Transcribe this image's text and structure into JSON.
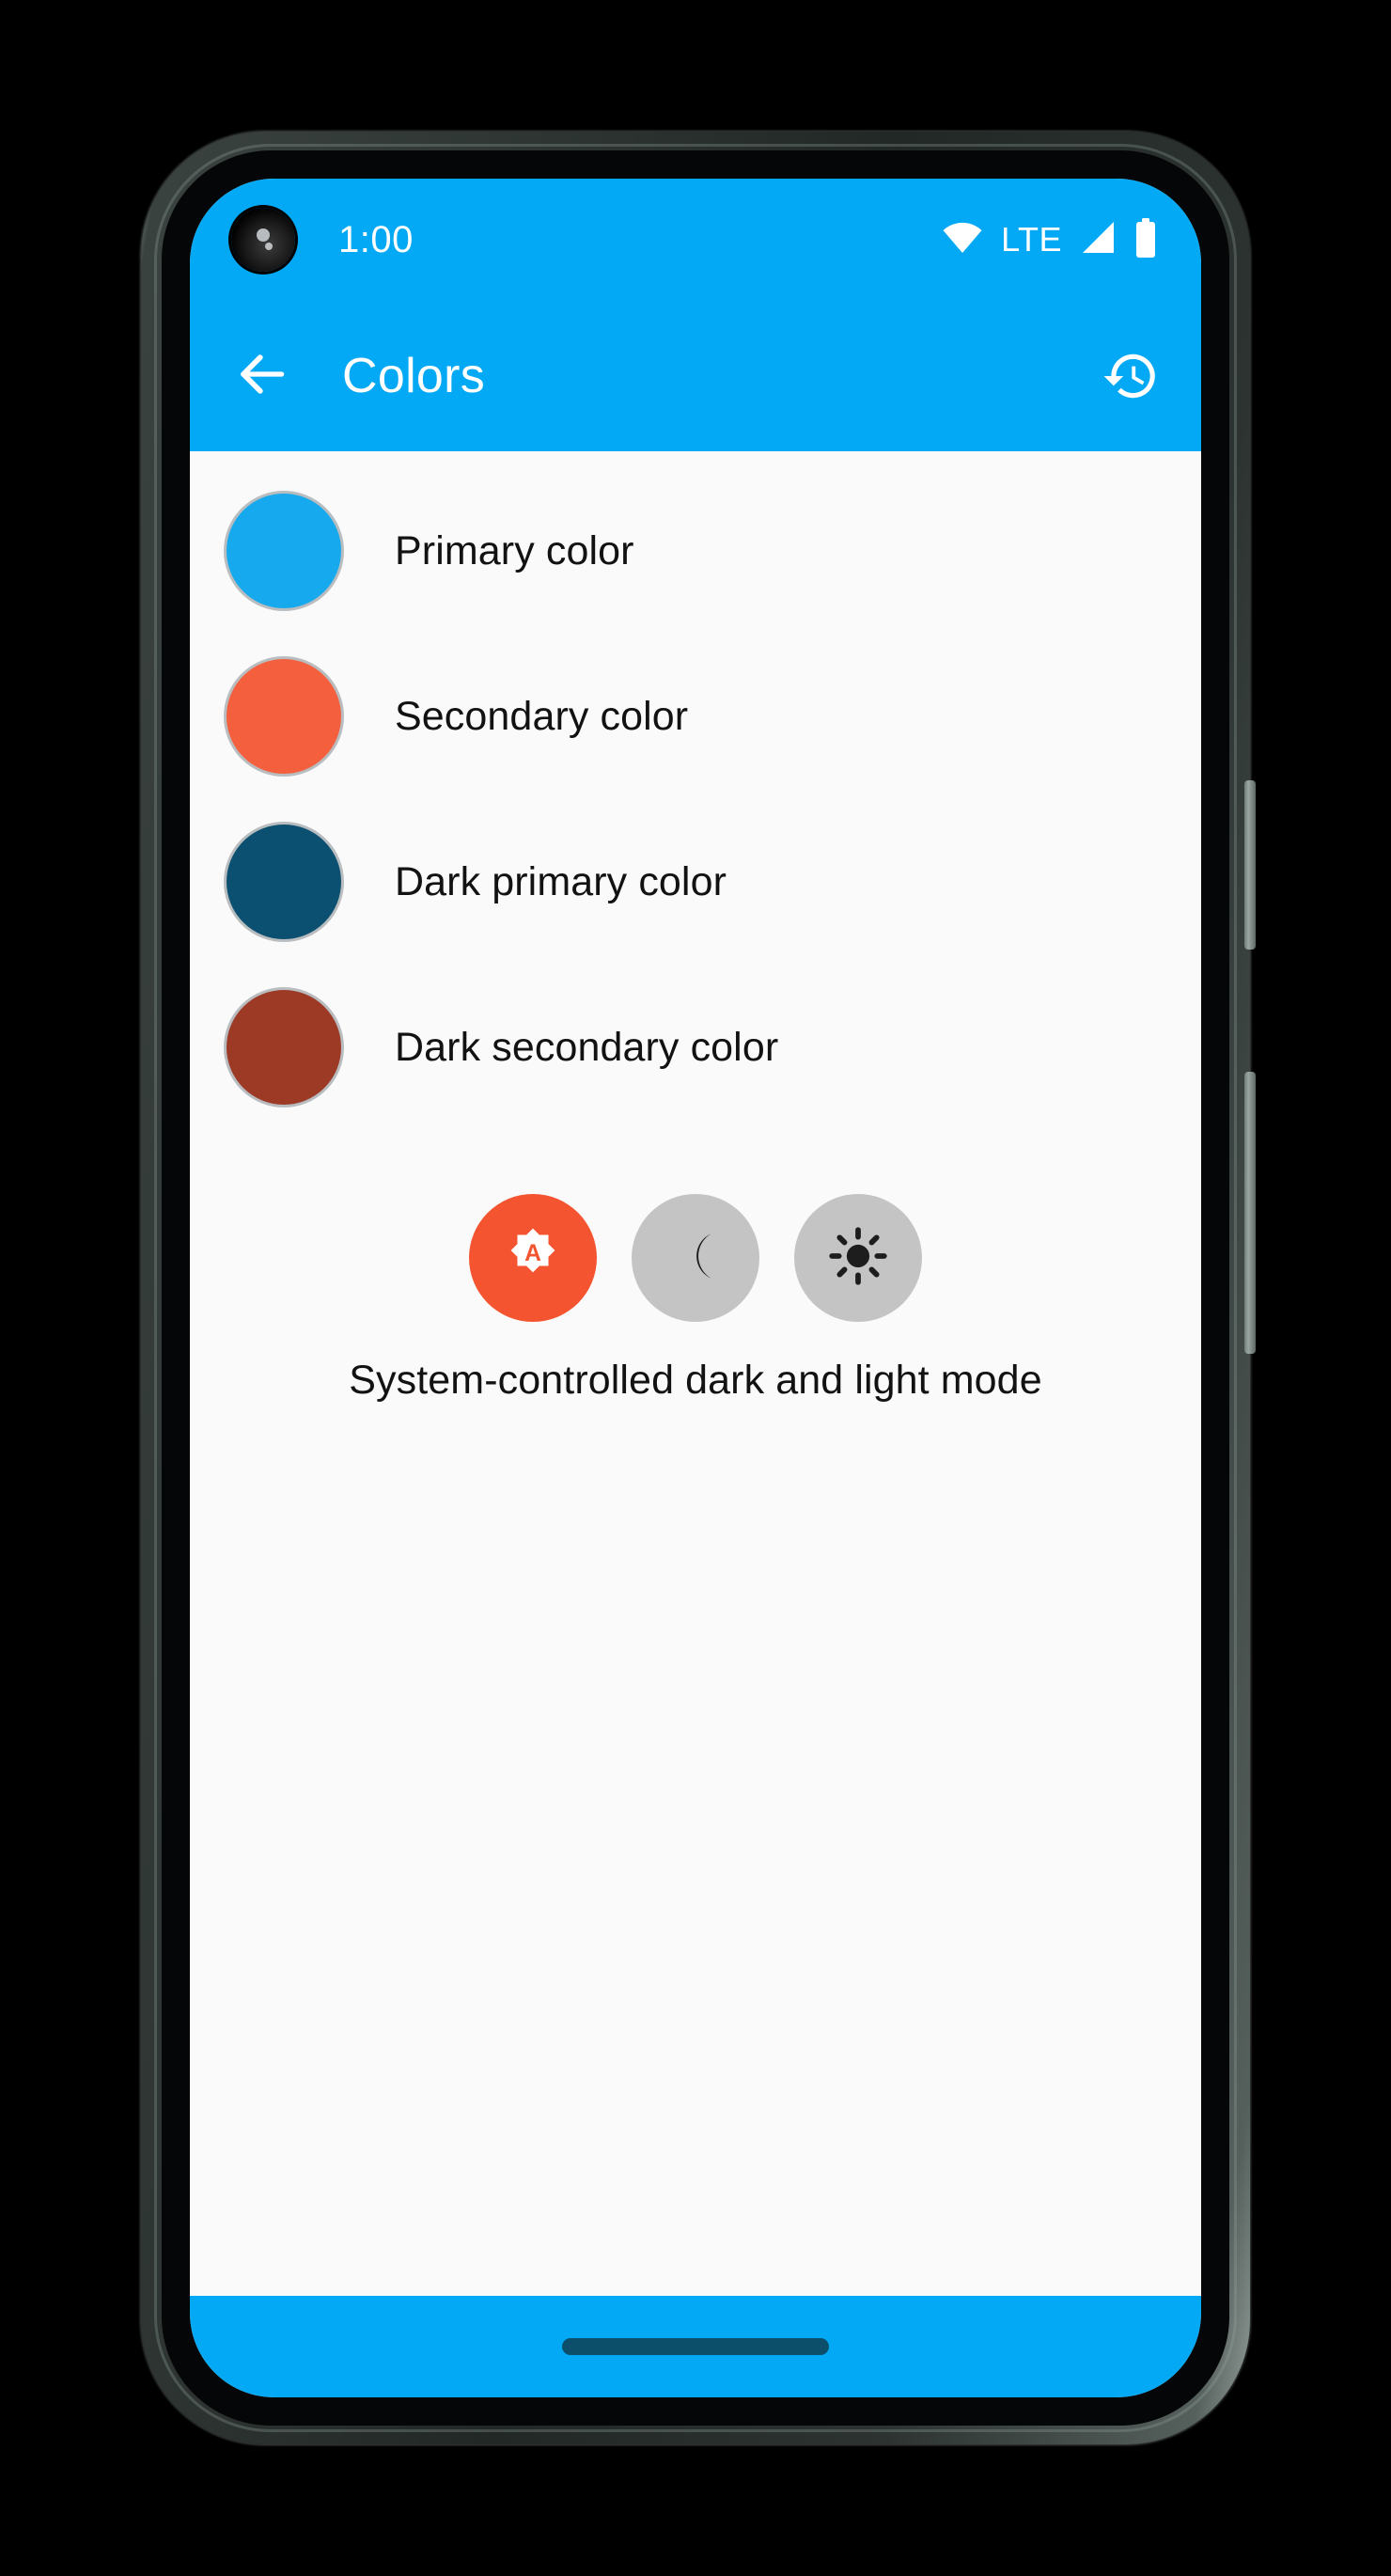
{
  "status_bar": {
    "time": "1:00",
    "network_label": "LTE",
    "icons": [
      "camera-punchhole",
      "wifi-icon",
      "signal-icon",
      "battery-icon"
    ],
    "background_color": "#03a9f4",
    "foreground_color": "#ffffff"
  },
  "app_bar": {
    "back_label": "back-arrow-icon",
    "title": "Colors",
    "history_label": "history-icon",
    "background_color": "#03a9f4"
  },
  "colors_list": [
    {
      "label": "Primary color",
      "swatch": "#17a9ee"
    },
    {
      "label": "Secondary color",
      "swatch": "#f4603e"
    },
    {
      "label": "Dark primary color",
      "swatch": "#0b5070"
    },
    {
      "label": "Dark secondary color",
      "swatch": "#9c3a26"
    }
  ],
  "theme_selector": {
    "modes": [
      {
        "name": "auto",
        "icon": "auto-brightness-icon",
        "selected": true,
        "background": "#f4542f"
      },
      {
        "name": "dark",
        "icon": "moon-icon",
        "selected": false,
        "background": "#c4c4c4"
      },
      {
        "name": "light",
        "icon": "sun-icon",
        "selected": false,
        "background": "#c4c4c4"
      }
    ],
    "caption": "System-controlled dark and light mode"
  },
  "navigation_bar": {
    "gesture_pill": "home-gesture-pill",
    "background_color": "#03a9f4",
    "pill_color": "#0c4f6b"
  },
  "device": {
    "frame_color": "#2c3331",
    "screen_background": "#fafafa"
  }
}
